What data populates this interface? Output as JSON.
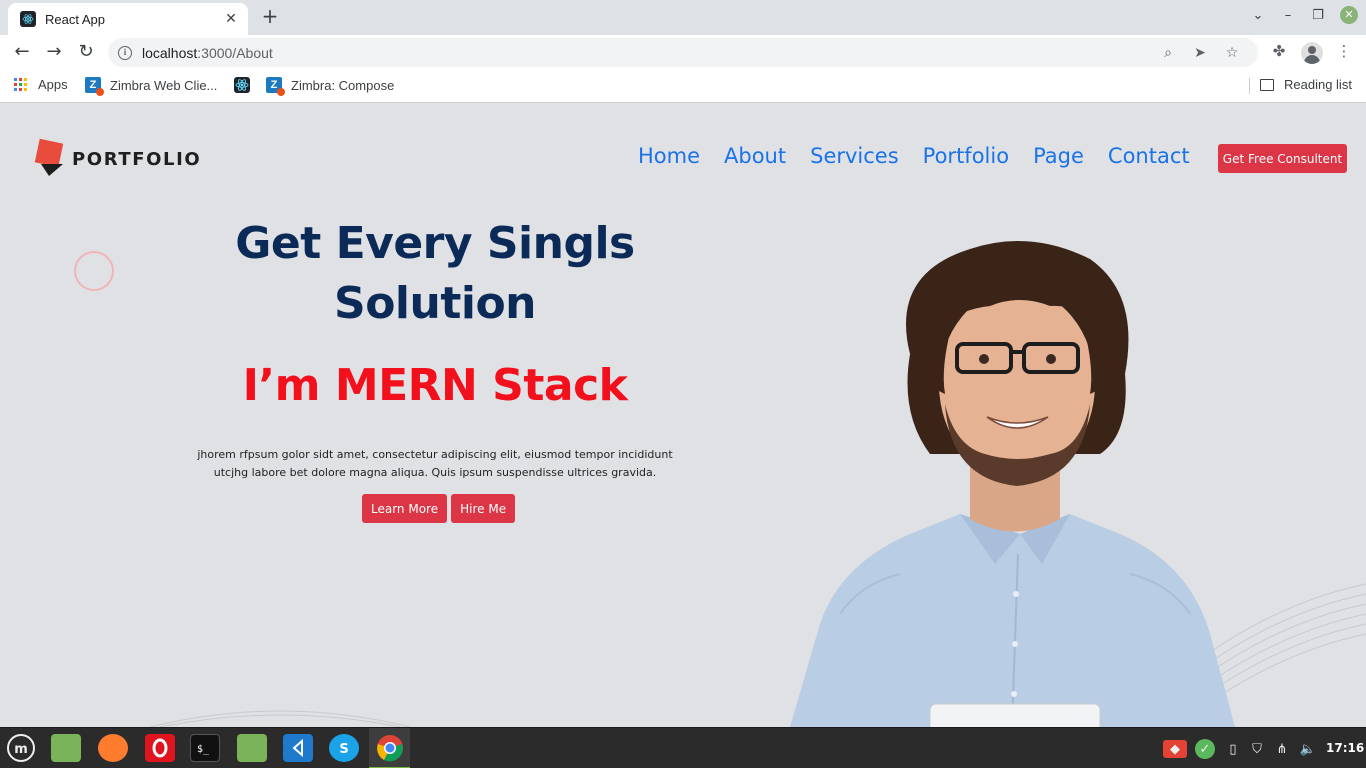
{
  "browser": {
    "tab_title": "React App",
    "new_tab": "+",
    "url_host": "localhost",
    "url_path": ":3000/About",
    "bookmarks": [
      {
        "label": "Apps",
        "icon": "apps-grid-icon"
      },
      {
        "label": "Zimbra Web Clie...",
        "icon": "zimbra-icon"
      },
      {
        "label": "",
        "icon": "react-icon"
      },
      {
        "label": "Zimbra: Compose",
        "icon": "zimbra-icon"
      }
    ],
    "reading_list": "Reading list"
  },
  "site": {
    "logo_text": "PORTFOLIO",
    "nav": [
      "Home",
      "About",
      "Services",
      "Portfolio",
      "Page",
      "Contact"
    ],
    "cta": "Get Free Consultent",
    "hero": {
      "title_line1": "Get Every Singls",
      "title_line2": "Solution",
      "subtitle": "I’m MERN Stack",
      "body_line1": "jhorem rfpsum golor sidt amet, consectetur adipiscing elit, eiusmod tempor incididunt",
      "body_line2": "utcjhg labore bet dolore magna aliqua. Quis ipsum suspendisse ultrices gravida.",
      "learn_more": "Learn More",
      "hire_me": "Hire Me"
    },
    "colors": {
      "accent": "#dc3545",
      "nav": "#1a73e8",
      "title": "#0b2a57",
      "subtitle": "#f2101c"
    }
  },
  "taskbar": {
    "apps": [
      "mint-menu-icon",
      "files-icon",
      "firefox-icon",
      "opera-icon",
      "terminal-icon",
      "folder-icon",
      "vscode-icon",
      "skype-icon",
      "chrome-icon"
    ],
    "clock": "17:16"
  }
}
